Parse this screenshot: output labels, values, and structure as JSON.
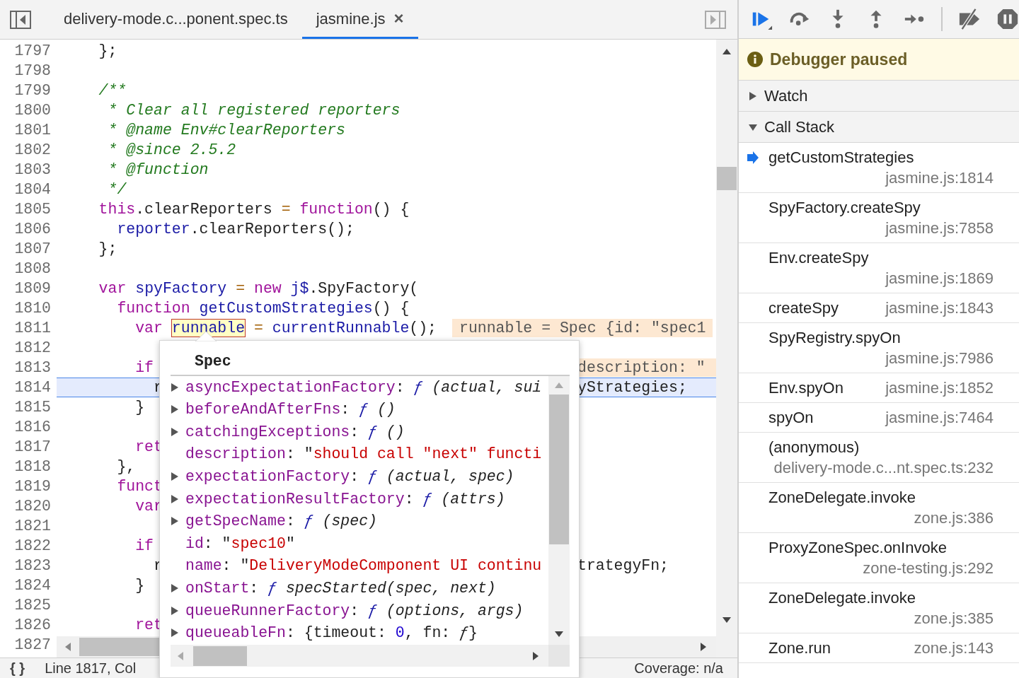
{
  "editor_tabs": [
    {
      "label": "delivery-mode.c...ponent.spec.ts",
      "selected": false
    },
    {
      "label": "jasmine.js",
      "selected": true,
      "close": "×"
    }
  ],
  "code": {
    "lines": [
      {
        "num": "1797",
        "current": false,
        "tokens": [
          {
            "kind": "plain",
            "text": "    };"
          }
        ]
      },
      {
        "num": "1798",
        "current": false
      },
      {
        "num": "1799",
        "current": false,
        "tokens": [
          {
            "kind": "comment",
            "text": "    /**"
          }
        ]
      },
      {
        "num": "1800",
        "current": false,
        "tokens": [
          {
            "kind": "comment",
            "text": "     * Clear all registered reporters"
          }
        ]
      },
      {
        "num": "1801",
        "current": false,
        "tokens": [
          {
            "kind": "comment",
            "text": "     * @name Env#clearReporters"
          }
        ]
      },
      {
        "num": "1802",
        "current": false,
        "tokens": [
          {
            "kind": "comment",
            "text": "     * @since 2.5.2"
          }
        ]
      },
      {
        "num": "1803",
        "current": false,
        "tokens": [
          {
            "kind": "comment",
            "text": "     * @function"
          }
        ]
      },
      {
        "num": "1804",
        "current": false,
        "tokens": [
          {
            "kind": "comment",
            "text": "     */"
          }
        ]
      },
      {
        "num": "1805",
        "current": false,
        "tokens": [
          {
            "kind": "kw",
            "text": "    this"
          },
          {
            "kind": "plain",
            "text": ".clearReporters "
          },
          {
            "kind": "op",
            "text": "="
          },
          {
            "kind": "kw",
            "text": " function"
          },
          {
            "kind": "plain",
            "text": "() {"
          }
        ]
      },
      {
        "num": "1806",
        "current": false,
        "tokens": [
          {
            "kind": "var",
            "text": "      reporter"
          },
          {
            "kind": "plain",
            "text": ".clearReporters();"
          }
        ]
      },
      {
        "num": "1807",
        "current": false,
        "tokens": [
          {
            "kind": "plain",
            "text": "    };"
          }
        ]
      },
      {
        "num": "1808",
        "current": false
      },
      {
        "num": "1809",
        "current": false,
        "tokens": [
          {
            "kind": "kw",
            "text": "    var"
          },
          {
            "kind": "var",
            "text": " spyFactory"
          },
          {
            "kind": "op",
            "text": " ="
          },
          {
            "kind": "kw",
            "text": " new"
          },
          {
            "kind": "var",
            "text": " j$"
          },
          {
            "kind": "plain",
            "text": ".SpyFactory("
          }
        ]
      },
      {
        "num": "1810",
        "current": false,
        "tokens": [
          {
            "kind": "kw",
            "text": "      function"
          },
          {
            "kind": "var",
            "text": " getCustomStrategies"
          },
          {
            "kind": "plain",
            "text": "() {"
          }
        ]
      },
      {
        "num": "1811",
        "current": false,
        "tokens": [
          {
            "kind": "kw",
            "text": "        var "
          },
          {
            "kind": "hover",
            "text": "runnable"
          },
          {
            "kind": "op",
            "text": " ="
          },
          {
            "kind": "var",
            "text": " currentRunnable"
          },
          {
            "kind": "plain",
            "text": "();"
          }
        ],
        "annotation": "runnable = Spec {id: \"spec1"
      },
      {
        "num": "1812",
        "current": false
      },
      {
        "num": "1813",
        "current": false,
        "tokens": [
          {
            "kind": "kw",
            "text": "        if"
          }
        ],
        "after_popup_annotation": "description: \""
      },
      {
        "num": "1814",
        "current": true,
        "tokens": [
          {
            "kind": "plain",
            "text": "          r"
          }
        ],
        "after_popup": [
          {
            "kind": "plain",
            "text": "yStrategies;"
          }
        ]
      },
      {
        "num": "1815",
        "current": false,
        "tokens": [
          {
            "kind": "plain",
            "text": "        }"
          }
        ]
      },
      {
        "num": "1816",
        "current": false
      },
      {
        "num": "1817",
        "current": false,
        "tokens": [
          {
            "kind": "kw",
            "text": "        ret"
          }
        ]
      },
      {
        "num": "1818",
        "current": false,
        "tokens": [
          {
            "kind": "plain",
            "text": "      },"
          }
        ]
      },
      {
        "num": "1819",
        "current": false,
        "tokens": [
          {
            "kind": "kw",
            "text": "      funct"
          }
        ]
      },
      {
        "num": "1820",
        "current": false,
        "tokens": [
          {
            "kind": "kw",
            "text": "        var"
          }
        ]
      },
      {
        "num": "1821",
        "current": false
      },
      {
        "num": "1822",
        "current": false,
        "tokens": [
          {
            "kind": "kw",
            "text": "        if"
          }
        ]
      },
      {
        "num": "1823",
        "current": false,
        "tokens": [
          {
            "kind": "plain",
            "text": "          r"
          }
        ],
        "after_popup": [
          {
            "kind": "plain",
            "text": "trategyFn;"
          }
        ]
      },
      {
        "num": "1824",
        "current": false,
        "tokens": [
          {
            "kind": "plain",
            "text": "        }"
          }
        ]
      },
      {
        "num": "1825",
        "current": false
      },
      {
        "num": "1826",
        "current": false,
        "tokens": [
          {
            "kind": "kw",
            "text": "        ret"
          }
        ]
      }
    ],
    "scrolled_line_number": "1827"
  },
  "popup": {
    "title": "Spec",
    "properties": [
      {
        "name": "asyncExpectationFactory",
        "expandable": true,
        "value": [
          {
            "kind": "plain",
            "text": ": "
          },
          {
            "kind": "fn",
            "text": "ƒ"
          },
          {
            "kind": "sig",
            "text": " (actual, sui"
          }
        ]
      },
      {
        "name": "beforeAndAfterFns",
        "expandable": true,
        "value": [
          {
            "kind": "plain",
            "text": ": "
          },
          {
            "kind": "fn",
            "text": "ƒ"
          },
          {
            "kind": "sig",
            "text": " ()"
          }
        ]
      },
      {
        "name": "catchingExceptions",
        "expandable": true,
        "value": [
          {
            "kind": "plain",
            "text": ": "
          },
          {
            "kind": "fn",
            "text": "ƒ"
          },
          {
            "kind": "sig",
            "text": " ()"
          }
        ]
      },
      {
        "name": "description",
        "expandable": false,
        "value": [
          {
            "kind": "plain",
            "text": ": \""
          },
          {
            "kind": "str",
            "text": "should call \"next\" functi"
          }
        ]
      },
      {
        "name": "expectationFactory",
        "expandable": true,
        "value": [
          {
            "kind": "plain",
            "text": ": "
          },
          {
            "kind": "fn",
            "text": "ƒ"
          },
          {
            "kind": "sig",
            "text": " (actual, spec)"
          }
        ]
      },
      {
        "name": "expectationResultFactory",
        "expandable": true,
        "value": [
          {
            "kind": "plain",
            "text": ": "
          },
          {
            "kind": "fn",
            "text": "ƒ"
          },
          {
            "kind": "sig",
            "text": " (attrs)"
          }
        ]
      },
      {
        "name": "getSpecName",
        "expandable": true,
        "value": [
          {
            "kind": "plain",
            "text": ": "
          },
          {
            "kind": "fn",
            "text": "ƒ"
          },
          {
            "kind": "sig",
            "text": " (spec)"
          }
        ]
      },
      {
        "name": "id",
        "expandable": false,
        "value": [
          {
            "kind": "plain",
            "text": ": \""
          },
          {
            "kind": "str",
            "text": "spec10"
          },
          {
            "kind": "plain",
            "text": "\""
          }
        ]
      },
      {
        "name": "name",
        "expandable": false,
        "value": [
          {
            "kind": "plain",
            "text": ": \""
          },
          {
            "kind": "str",
            "text": "DeliveryModeComponent UI continu"
          }
        ]
      },
      {
        "name": "onStart",
        "expandable": true,
        "value": [
          {
            "kind": "plain",
            "text": ": "
          },
          {
            "kind": "fn",
            "text": "ƒ"
          },
          {
            "kind": "sig",
            "text": " specStarted(spec, next)"
          }
        ]
      },
      {
        "name": "queueRunnerFactory",
        "expandable": true,
        "value": [
          {
            "kind": "plain",
            "text": ": "
          },
          {
            "kind": "fn",
            "text": "ƒ"
          },
          {
            "kind": "sig",
            "text": " (options, args)"
          }
        ]
      },
      {
        "name": "queueableFn",
        "expandable": true,
        "value": [
          {
            "kind": "plain",
            "text": ": {timeout: "
          },
          {
            "kind": "num",
            "text": "0"
          },
          {
            "kind": "plain",
            "text": ", fn: "
          },
          {
            "kind": "sig",
            "text": "ƒ"
          },
          {
            "kind": "plain",
            "text": "}"
          }
        ]
      }
    ]
  },
  "status_bar": {
    "format_button": "{ }",
    "position": "Line 1817, Col",
    "coverage": "Coverage: n/a"
  },
  "debugger": {
    "banner": "Debugger paused",
    "sections": [
      {
        "label": "Watch",
        "expanded": false
      },
      {
        "label": "Call Stack",
        "expanded": true
      }
    ],
    "call_stack": [
      {
        "name": "getCustomStrategies",
        "location": "jasmine.js:1814",
        "selected": true
      },
      {
        "name": "SpyFactory.createSpy",
        "location": "jasmine.js:7858",
        "selected": false
      },
      {
        "name": "Env.createSpy",
        "location": "jasmine.js:1869",
        "selected": false
      },
      {
        "name": "createSpy",
        "location": "jasmine.js:1843",
        "selected": false
      },
      {
        "name": "SpyRegistry.spyOn",
        "location": "jasmine.js:7986",
        "selected": false
      },
      {
        "name": "Env.spyOn",
        "location": "jasmine.js:1852",
        "selected": false
      },
      {
        "name": "spyOn",
        "location": "jasmine.js:7464",
        "selected": false
      },
      {
        "name": "(anonymous)",
        "location": "delivery-mode.c...nt.spec.ts:232",
        "selected": false
      },
      {
        "name": "ZoneDelegate.invoke",
        "location": "zone.js:386",
        "selected": false
      },
      {
        "name": "ProxyZoneSpec.onInvoke",
        "location": "zone-testing.js:292",
        "selected": false
      },
      {
        "name": "ZoneDelegate.invoke",
        "location": "zone.js:385",
        "selected": false
      },
      {
        "name": "Zone.run",
        "location": "zone.js:143",
        "selected": false
      }
    ]
  }
}
